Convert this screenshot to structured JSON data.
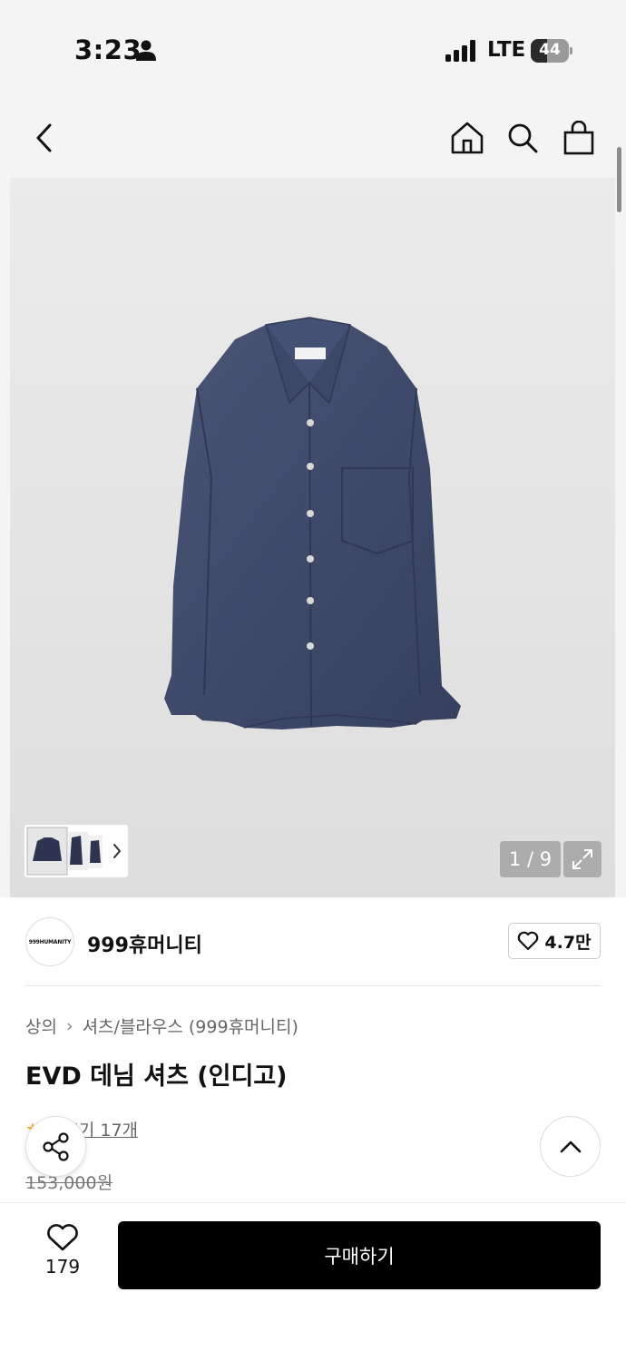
{
  "status_bar": {
    "time": "3:23",
    "network": "LTE",
    "battery": "44",
    "battery_level": 0.44,
    "icons": [
      "person-icon",
      "signal-icon",
      "battery-icon"
    ]
  },
  "nav": {
    "icons": [
      "back-chevron-icon",
      "home-icon",
      "search-icon",
      "shopping-bag-icon"
    ]
  },
  "gallery": {
    "counter": "1 / 9",
    "current": 1,
    "total": 9,
    "thumbnail_count": 3,
    "background": "#e6e6e6",
    "product_color": "#3e4a6b"
  },
  "brand": {
    "logo_text": "999HUMANITY",
    "name": "999휴머니티",
    "likes": "4.7만"
  },
  "product": {
    "breadcrumb": [
      "상의",
      "셔츠/블라우스 (999휴머니티)"
    ],
    "title": "EVD 데님 셔츠 (인디고)",
    "rating_visible": "0",
    "reviews": "후기 17개",
    "original_price": "153,000원"
  },
  "bottom_bar": {
    "wish_count": "179",
    "buy_label": "구매하기"
  },
  "colors": {
    "accent": "#000000",
    "star": "#f5a623",
    "muted_text": "#666666"
  }
}
